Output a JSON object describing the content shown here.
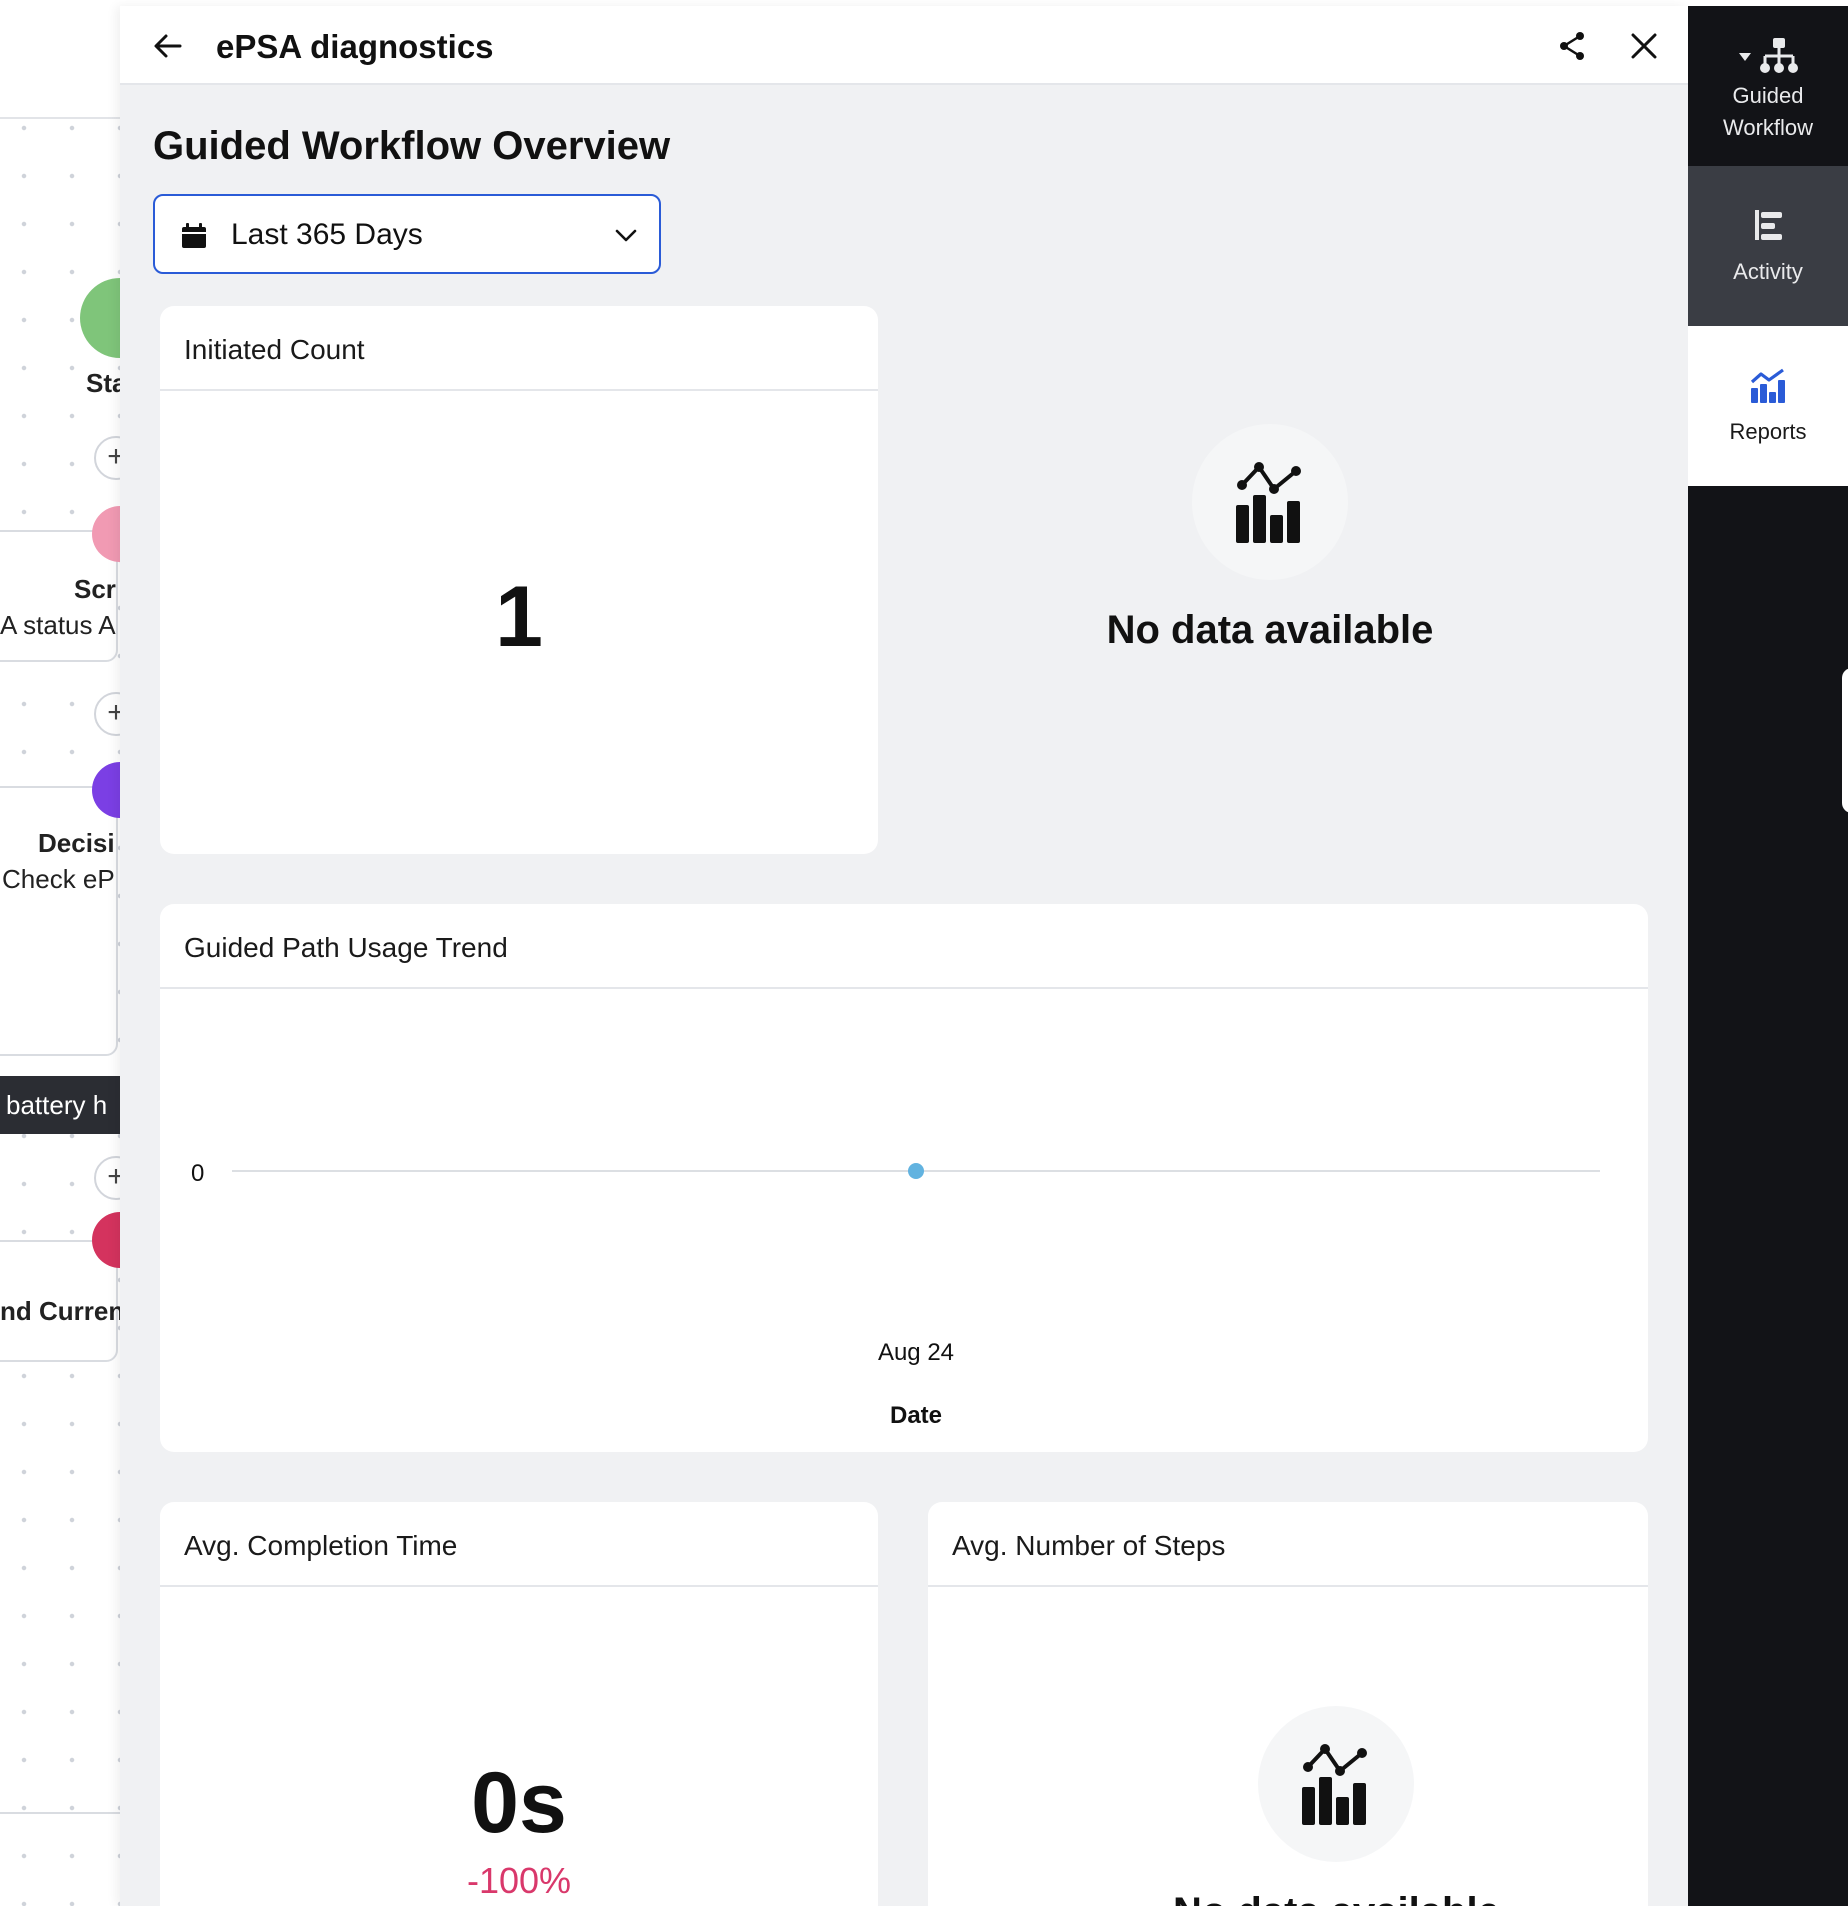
{
  "canvas": {
    "node_start_label": "Sta",
    "node_screen_label": "Scr",
    "node_screen_sub": "A status A",
    "node_decision_label": "Decisi",
    "node_decision_sub": "Check eP",
    "node_battery_label": "battery h",
    "node_end_label": "nd Curren",
    "plus_symbol": "+"
  },
  "panel": {
    "title": "ePSA diagnostics",
    "overview_title": "Guided Workflow Overview",
    "date_range": "Last 365 Days"
  },
  "initiated": {
    "title": "Initiated Count",
    "value": "1"
  },
  "nodata_text": "No data available",
  "trend": {
    "title": "Guided Path Usage Trend"
  },
  "chart_data": {
    "type": "line",
    "title": "Guided Path Usage Trend",
    "x": [
      "Aug 24"
    ],
    "series": [
      {
        "values": [
          0
        ]
      }
    ],
    "y_tick_labels": [
      "0"
    ],
    "xlabel": "Date",
    "ylabel": "",
    "grid": true,
    "point_color": "#62b3e0"
  },
  "completion": {
    "title": "Avg. Completion Time",
    "value": "0s",
    "change": "-100%",
    "change_color": "#d9386b"
  },
  "steps": {
    "title": "Avg. Number of Steps"
  },
  "sidebar": {
    "guided_line1": "Guided",
    "guided_line2": "Workflow",
    "activity": "Activity",
    "reports": "Reports",
    "reports_color": "#2a5bd7"
  },
  "icons": [
    "back-arrow-icon",
    "share-icon",
    "close-icon",
    "calendar-icon",
    "chevron-down-icon",
    "chart-icon",
    "caret-down-icon",
    "sitemap-icon",
    "activity-icon",
    "reports-icon"
  ]
}
